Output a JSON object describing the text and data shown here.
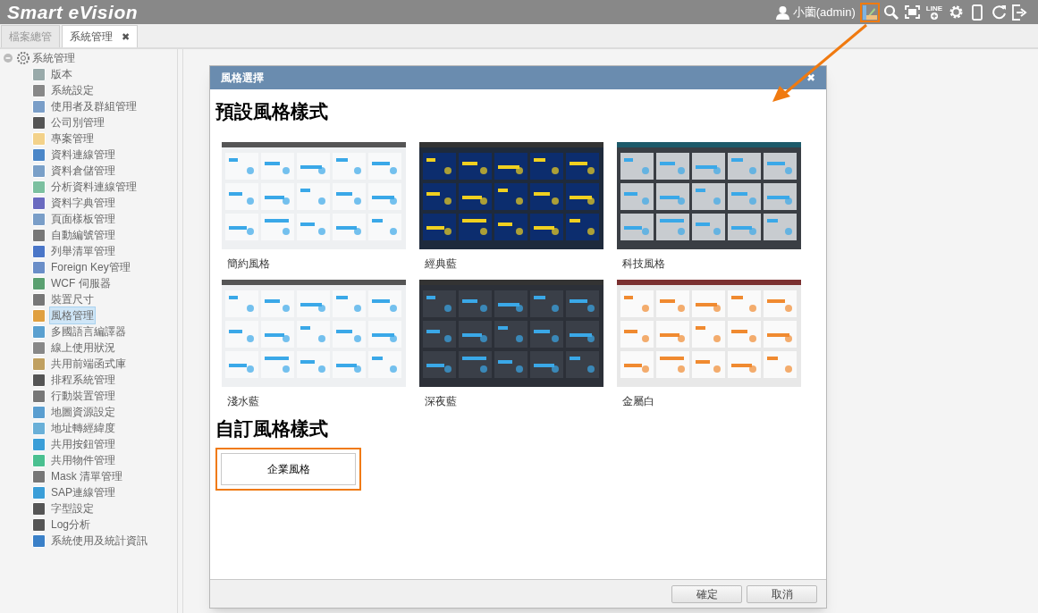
{
  "app": {
    "title": "Smart eVision",
    "user": "小薗(admin)"
  },
  "toolbar": [
    {
      "kind": "palette",
      "highlighted": true
    },
    {
      "kind": "search",
      "highlighted": false
    },
    {
      "kind": "fullscreen",
      "highlighted": false
    },
    {
      "kind": "line",
      "label": "LINE",
      "highlighted": false
    },
    {
      "kind": "settings",
      "highlighted": false
    },
    {
      "kind": "device",
      "highlighted": false
    },
    {
      "kind": "refresh",
      "highlighted": false
    },
    {
      "kind": "logout",
      "highlighted": false
    }
  ],
  "tabs": [
    {
      "label": "檔案總管",
      "selected": false
    },
    {
      "label": "系統管理",
      "selected": true,
      "close": "✖"
    }
  ],
  "sidebar": {
    "root": {
      "label": "系統管理",
      "expanded": true,
      "children": [
        {
          "label": "版本",
          "selected": false
        },
        {
          "label": "系統設定",
          "selected": false
        },
        {
          "label": "使用者及群組管理",
          "selected": false
        },
        {
          "label": "公司別管理",
          "selected": false
        },
        {
          "label": "專案管理",
          "selected": false
        },
        {
          "label": "資料連線管理",
          "selected": false
        },
        {
          "label": "資料倉儲管理",
          "selected": false
        },
        {
          "label": "分析資料連線管理",
          "selected": false
        },
        {
          "label": "資料字典管理",
          "selected": false
        },
        {
          "label": "頁面樣板管理",
          "selected": false
        },
        {
          "label": "自動編號管理",
          "selected": false
        },
        {
          "label": "列舉清單管理",
          "selected": false
        },
        {
          "label": "Foreign Key管理",
          "selected": false
        },
        {
          "label": "WCF 伺服器",
          "selected": false
        },
        {
          "label": "裝置尺寸",
          "selected": false
        },
        {
          "label": "風格管理",
          "selected": true
        },
        {
          "label": "多國語言編譯器",
          "selected": false
        },
        {
          "label": "線上使用狀況",
          "selected": false
        },
        {
          "label": "共用前端函式庫",
          "selected": false
        },
        {
          "label": "排程系統管理",
          "selected": false
        },
        {
          "label": "行動裝置管理",
          "selected": false
        },
        {
          "label": "地圖資源設定",
          "selected": false
        },
        {
          "label": "地址轉經緯度",
          "selected": false
        },
        {
          "label": "共用按鈕管理",
          "selected": false
        },
        {
          "label": "共用物件管理",
          "selected": false
        },
        {
          "label": "Mask 清單管理",
          "selected": false
        },
        {
          "label": "SAP連線管理",
          "selected": false
        },
        {
          "label": "字型設定",
          "selected": false
        },
        {
          "label": "Log分析",
          "selected": false
        },
        {
          "label": "系統使用及統計資訊",
          "selected": false
        }
      ]
    }
  },
  "dialog": {
    "title": "風格選擇",
    "close": "✖",
    "preset_heading": "預設風格樣式",
    "presets": [
      {
        "label": "簡約風格",
        "kind": "light"
      },
      {
        "label": "經典藍",
        "kind": "classic"
      },
      {
        "label": "科技風格",
        "kind": "tech"
      },
      {
        "label": "淺水藍",
        "kind": "light"
      },
      {
        "label": "深夜藍",
        "kind": "dark"
      },
      {
        "label": "金屬白",
        "kind": "metal"
      }
    ],
    "custom_heading": "自訂風格樣式",
    "custom": [
      {
        "label": "企業風格",
        "highlighted": true
      }
    ],
    "buttons": [
      "確定",
      "取消"
    ]
  },
  "annotation": {
    "arrow": true
  }
}
